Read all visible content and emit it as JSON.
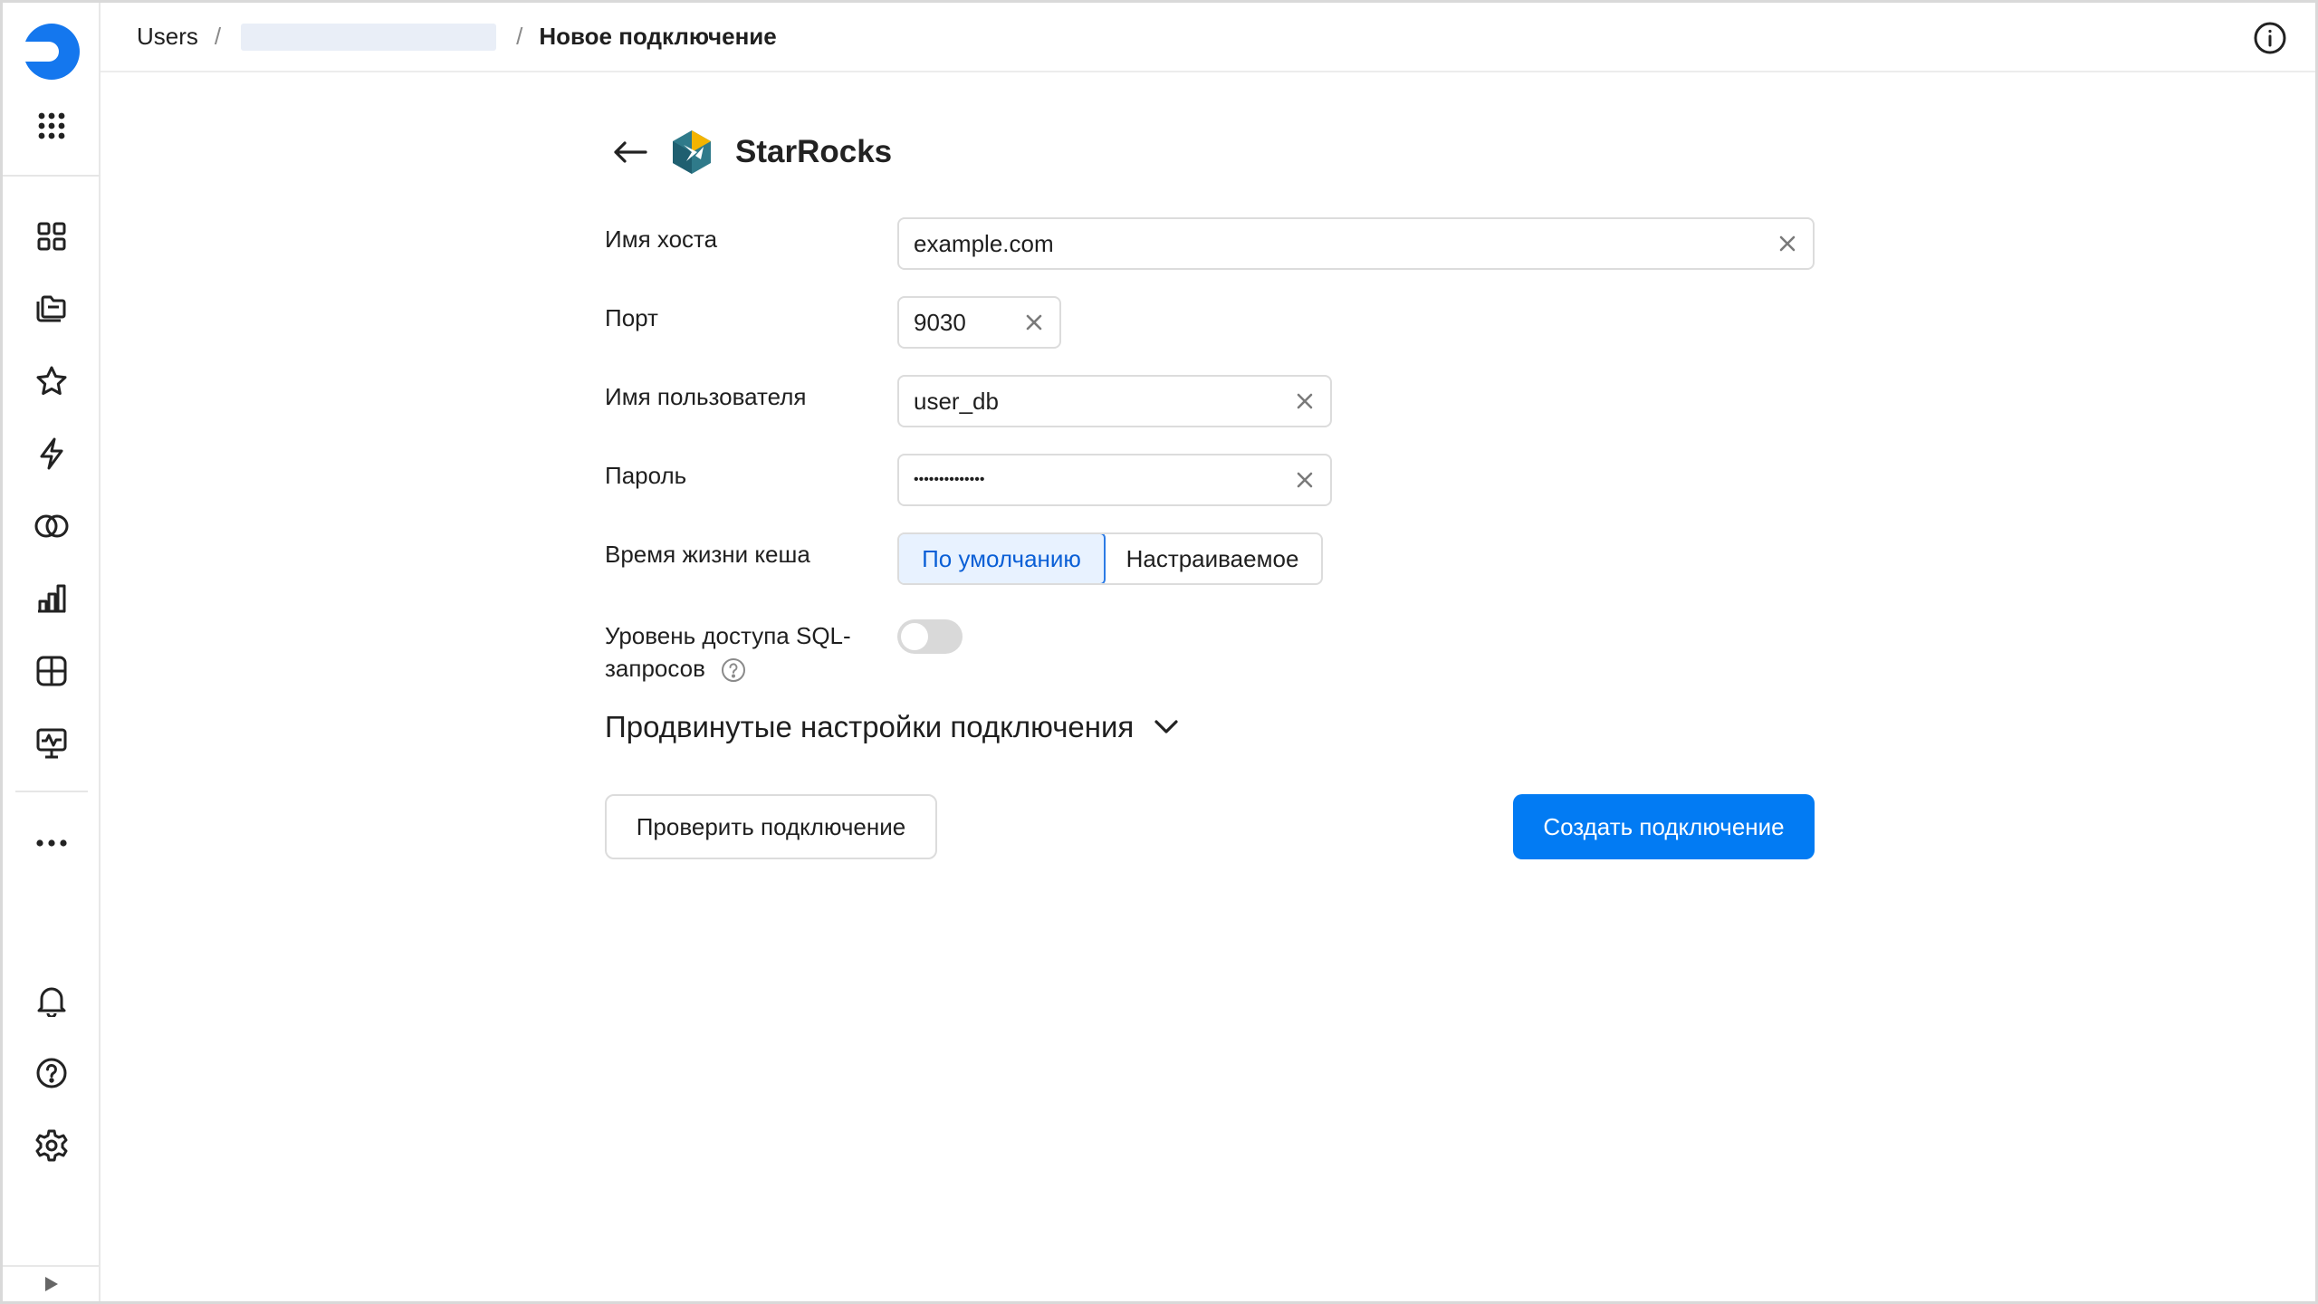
{
  "breadcrumb": {
    "root": "Users",
    "separator": "/",
    "current": "Новое подключение"
  },
  "connection": {
    "name": "StarRocks"
  },
  "form": {
    "hostname": {
      "label": "Имя хоста",
      "value": "example.com"
    },
    "port": {
      "label": "Порт",
      "value": "9030"
    },
    "username": {
      "label": "Имя пользователя",
      "value": "user_db"
    },
    "password": {
      "label": "Пароль",
      "value": "••••••••••••••"
    },
    "cache_ttl": {
      "label": "Время жизни кеша",
      "options": [
        "По умолчанию",
        "Настраиваемое"
      ],
      "selected": "По умолчанию"
    },
    "sql_access": {
      "label_line1": "Уровень доступа SQL-",
      "label_line2": "запросов",
      "enabled": false
    }
  },
  "advanced": {
    "label": "Продвинутые настройки подключения"
  },
  "actions": {
    "check_label": "Проверить подключение",
    "create_label": "Создать подключение"
  },
  "colors": {
    "accent": "#027bf3",
    "brand": "#1477ee",
    "segment_active_bg": "#e8f2ff"
  },
  "sidebar_icons": [
    "collections-icon",
    "workbooks-icon",
    "favorites-icon",
    "connections-icon",
    "datasets-icon",
    "charts-icon",
    "dashboards-icon",
    "monitoring-icon",
    "more-icon",
    "notifications-icon",
    "help-icon",
    "settings-icon"
  ]
}
